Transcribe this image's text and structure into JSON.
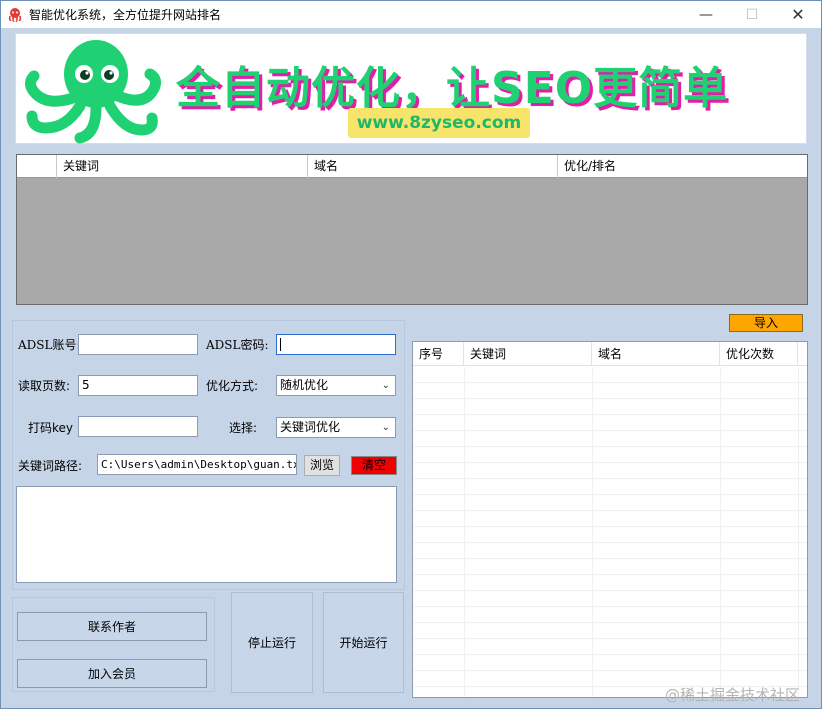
{
  "window": {
    "title": "智能优化系统，全方位提升网站排名",
    "minimize_icon": "minimize-icon",
    "maximize_icon": "maximize-icon",
    "close_icon": "close-icon",
    "minimize_glyph": "—",
    "maximize_glyph": "☐",
    "close_glyph": "✕"
  },
  "banner": {
    "slogan": "全自动优化，让SEO更简单",
    "url": "www.8zyseo.com",
    "mascot_icon": "octopus-icon",
    "colors": {
      "mascot": "#1fd173",
      "shadow": "#e01ea8",
      "url_bg": "#f7e46b"
    }
  },
  "keyword_grid": {
    "columns": [
      "",
      "关键词",
      "域名",
      "优化/排名"
    ]
  },
  "form": {
    "adsl_account_label": "ADSL账号:",
    "adsl_account_value": "",
    "adsl_password_label": "ADSL密码:",
    "adsl_password_value": "",
    "read_pages_label": "读取页数:",
    "read_pages_value": "5",
    "optimize_mode_label": "优化方式:",
    "optimize_mode_value": "随机优化",
    "captcha_key_label": "打码key",
    "captcha_key_value": "",
    "select_label": "选择:",
    "select_value": "关键词优化",
    "keyword_path_label": "关键词路径:",
    "keyword_path_value": "C:\\Users\\admin\\Desktop\\guan.txt",
    "browse_label": "浏览",
    "clear_label": "清空"
  },
  "buttons": {
    "contact_author": "联系作者",
    "join_member": "加入会员",
    "stop_run": "停止运行",
    "start_run": "开始运行",
    "import": "导入"
  },
  "result_grid": {
    "columns": [
      "序号",
      "关键词",
      "域名",
      "优化次数"
    ]
  },
  "watermark": "@稀土掘金技术社区"
}
